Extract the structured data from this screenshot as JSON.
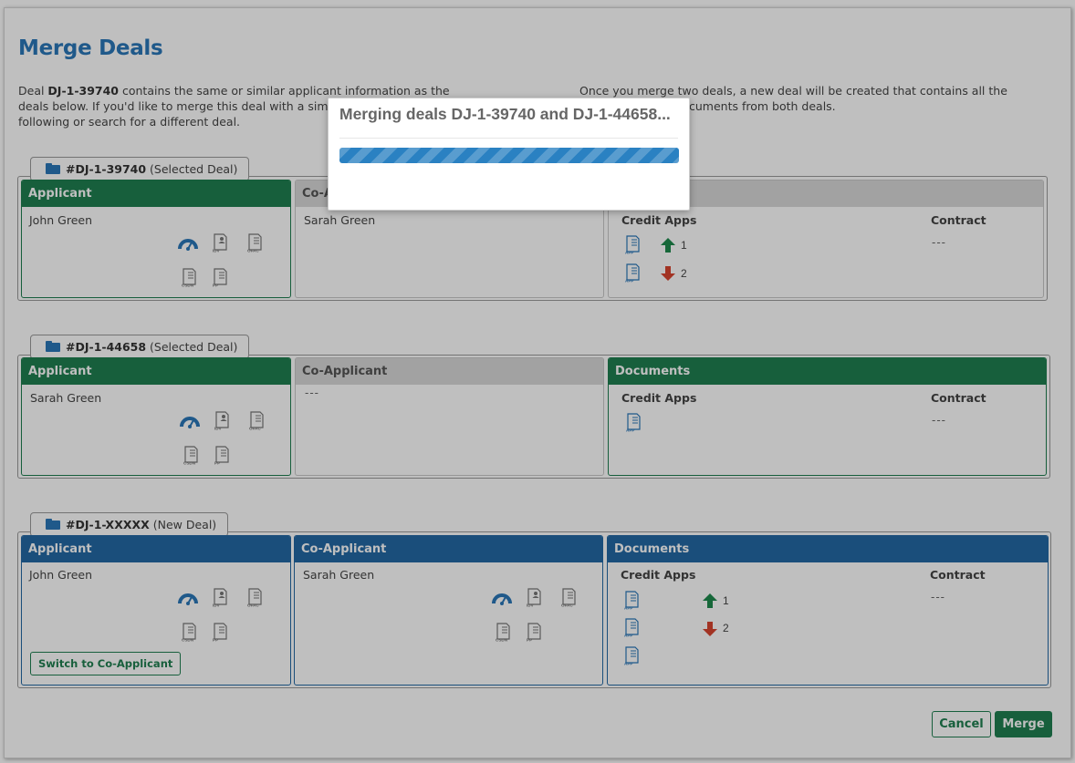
{
  "page": {
    "title": "Merge Deals",
    "intro_left_parts": [
      "Deal ",
      "DJ-1-39740",
      " contains the same or similar applicant information as the deals below. If you'd like to merge this deal with a similar deal, p",
      "following or search for a different deal."
    ],
    "intro_right_parts": [
      "Once you merge two deals, a new deal will be created that contains all the",
      "cuments from both deals."
    ]
  },
  "deals": [
    {
      "id": "#DJ-1-39740",
      "tag": "(Selected Deal)",
      "applicant": {
        "header": "Applicant",
        "name": "John Green",
        "icons": [
          "gauge-icon",
          "idv-doc-icon",
          "ofac-doc-icon",
          "csdn-doc-icon",
          "pp-doc-icon"
        ]
      },
      "coapplicant": {
        "header": "Co-A",
        "name": "Sarah Green"
      },
      "documents": {
        "header": "",
        "credit_apps_label": "Credit Apps",
        "contract_label": "Contract",
        "contract_value": "---",
        "apps": [
          {
            "dir": "up",
            "label": "1"
          },
          {
            "dir": "down",
            "label": "2"
          }
        ]
      }
    },
    {
      "id": "#DJ-1-44658",
      "tag": "(Selected Deal)",
      "applicant": {
        "header": "Applicant",
        "name": "Sarah Green",
        "icons": [
          "gauge-icon",
          "idv-doc-icon",
          "ofac-doc-icon",
          "csdn-doc-icon",
          "pp-doc-icon"
        ]
      },
      "coapplicant": {
        "header": "Co-Applicant",
        "name": "---"
      },
      "documents": {
        "header": "Documents",
        "credit_apps_label": "Credit Apps",
        "contract_label": "Contract",
        "contract_value": "---"
      }
    },
    {
      "id": "#DJ-1-XXXXX",
      "tag": "(New Deal)",
      "applicant": {
        "header": "Applicant",
        "name": "John Green",
        "switch_label": "Switch to Co-Applicant"
      },
      "coapplicant": {
        "header": "Co-Applicant",
        "name": "Sarah Green"
      },
      "documents": {
        "header": "Documents",
        "credit_apps_label": "Credit Apps",
        "contract_label": "Contract",
        "contract_value": "---",
        "apps": [
          {
            "dir": "up",
            "label": "1"
          },
          {
            "dir": "down",
            "label": "2"
          }
        ]
      }
    }
  ],
  "doc_icon_labels": {
    "idv": "IDV",
    "ofac": "OFAC",
    "csdn": "CSDN",
    "pp": "PP",
    "app": "APP"
  },
  "footer": {
    "cancel_label": "Cancel",
    "merge_label": "Merge"
  },
  "modal": {
    "title": "Merging deals DJ-1-39740 and DJ-1-44658...",
    "progress": 1.0
  },
  "colors": {
    "title_blue": "#2a77b9",
    "green": "#1f7f50",
    "blue_header": "#2369a4",
    "arrow_up": "#1e8a4c",
    "arrow_down": "#d9452f",
    "progress": "#2a81c2"
  }
}
